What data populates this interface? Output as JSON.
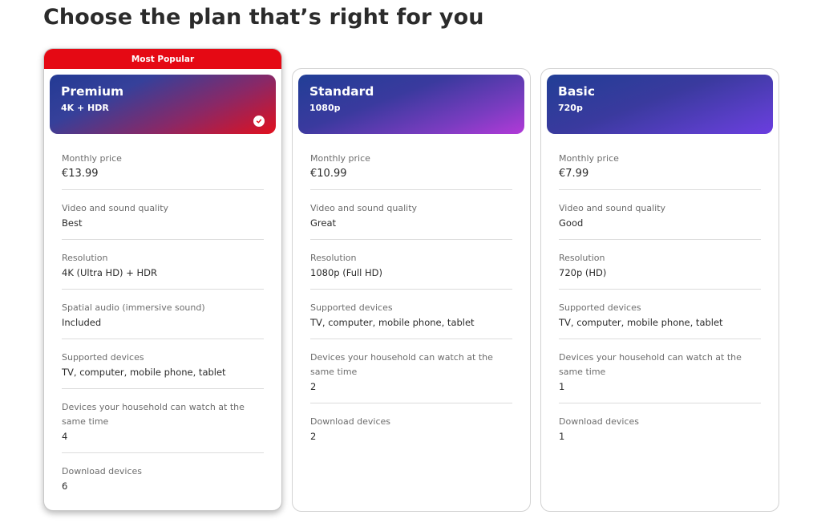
{
  "page": {
    "title": "Choose the plan that’s right for you"
  },
  "colors": {
    "accent_red": "#e50914",
    "divider": "#dcdcdc"
  },
  "plans": [
    {
      "badge": "Most Popular",
      "name": "Premium",
      "resolution_short": "4K + HDR",
      "selected": true,
      "selected_icon": "check-circle-icon",
      "features": [
        {
          "label": "Monthly price",
          "value": "€13.99"
        },
        {
          "label": "Video and sound quality",
          "value": "Best"
        },
        {
          "label": "Resolution",
          "value": "4K (Ultra HD) + HDR"
        },
        {
          "label": "Spatial audio (immersive sound)",
          "value": "Included"
        },
        {
          "label": "Supported devices",
          "value": "TV, computer, mobile phone, tablet"
        },
        {
          "label": "Devices your household can watch at the same time",
          "value": "4"
        },
        {
          "label": "Download devices",
          "value": "6"
        }
      ]
    },
    {
      "name": "Standard",
      "resolution_short": "1080p",
      "selected": false,
      "features": [
        {
          "label": "Monthly price",
          "value": "€10.99"
        },
        {
          "label": "Video and sound quality",
          "value": "Great"
        },
        {
          "label": "Resolution",
          "value": "1080p (Full HD)"
        },
        {
          "label": "Supported devices",
          "value": "TV, computer, mobile phone, tablet"
        },
        {
          "label": "Devices your household can watch at the same time",
          "value": "2"
        },
        {
          "label": "Download devices",
          "value": "2"
        }
      ]
    },
    {
      "name": "Basic",
      "resolution_short": "720p",
      "selected": false,
      "features": [
        {
          "label": "Monthly price",
          "value": "€7.99"
        },
        {
          "label": "Video and sound quality",
          "value": "Good"
        },
        {
          "label": "Resolution",
          "value": "720p (HD)"
        },
        {
          "label": "Supported devices",
          "value": "TV, computer, mobile phone, tablet"
        },
        {
          "label": "Devices your household can watch at the same time",
          "value": "1"
        },
        {
          "label": "Download devices",
          "value": "1"
        }
      ]
    }
  ]
}
